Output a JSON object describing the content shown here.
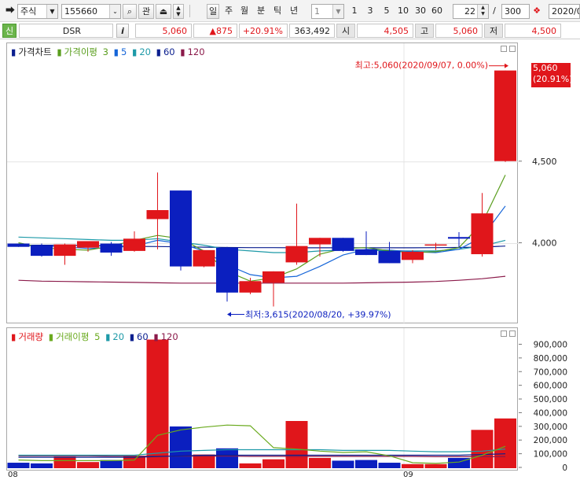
{
  "toolbar": {
    "market": "주식",
    "code": "155660",
    "search_label": "관",
    "periods": [
      "일",
      "주",
      "월",
      "분",
      "틱",
      "년"
    ],
    "active_period": "일",
    "interval_value": "1",
    "quick_intervals": [
      "1",
      "3",
      "5",
      "10",
      "30",
      "60"
    ],
    "display_count": "22",
    "total_count": "300",
    "count_separator": "/",
    "date_value": "2020/0"
  },
  "quote": {
    "signal": "신",
    "name": "DSR",
    "info_label": "i",
    "price": "5,060",
    "change": "▲875",
    "change_rate": "+20.91%",
    "volume": "363,492",
    "open_label": "시",
    "open": "4,505",
    "high_label": "고",
    "high": "5,060",
    "low_label": "저",
    "low": "4,500"
  },
  "price_panel": {
    "legend": {
      "title": "가격차트",
      "ma_title": "가격이평",
      "ma_periods": [
        "3",
        "5",
        "20",
        "60",
        "120"
      ]
    },
    "high_annotation": "최고:5,060(2020/09/07, 0.00%)",
    "low_annotation": "최저:3,615(2020/08/20, +39.97%)",
    "current_tag": {
      "price": "5,060",
      "rate": "(20.91%)"
    },
    "axis_ticks": [
      "4,500",
      "4,000"
    ]
  },
  "volume_panel": {
    "legend": {
      "title": "거래량",
      "ma_title": "거래이평",
      "ma_periods": [
        "5",
        "20",
        "60",
        "120"
      ]
    },
    "axis_ticks": [
      "900,000",
      "800,000",
      "700,000",
      "600,000",
      "500,000",
      "400,000",
      "300,000",
      "200,000",
      "100,000",
      "0"
    ]
  },
  "date_axis": {
    "labels": [
      "08",
      "09"
    ]
  },
  "colors": {
    "up": "#e0161b",
    "down": "#0b1fbf",
    "ma3": "#5a9e1e",
    "ma5": "#1565d8",
    "ma20": "#1e9aa8",
    "ma60": "#0b1f8f",
    "ma120": "#8b1a4a",
    "vma5": "#6aaa1e"
  },
  "chart_data": {
    "type": "candlestick",
    "ylim": [
      3540,
      5140
    ],
    "candles": [
      {
        "o": 4000,
        "h": 4000,
        "l": 3980,
        "c": 3980
      },
      {
        "o": 3990,
        "h": 4000,
        "l": 3920,
        "c": 3925
      },
      {
        "o": 3925,
        "h": 4000,
        "l": 3870,
        "c": 3995
      },
      {
        "o": 3975,
        "h": 4005,
        "l": 3950,
        "c": 4015
      },
      {
        "o": 4000,
        "h": 4010,
        "l": 3925,
        "c": 3945
      },
      {
        "o": 3955,
        "h": 4075,
        "l": 3950,
        "c": 4030
      },
      {
        "o": 4150,
        "h": 4435,
        "l": 3965,
        "c": 4205
      },
      {
        "o": 4325,
        "h": 4325,
        "l": 3835,
        "c": 3860
      },
      {
        "o": 3860,
        "h": 3960,
        "l": 3855,
        "c": 3960
      },
      {
        "o": 3975,
        "h": 3980,
        "l": 3645,
        "c": 3700
      },
      {
        "o": 3700,
        "h": 3790,
        "l": 3690,
        "c": 3770
      },
      {
        "o": 3760,
        "h": 3830,
        "l": 3615,
        "c": 3830
      },
      {
        "o": 3885,
        "h": 4245,
        "l": 3870,
        "c": 3985
      },
      {
        "o": 3995,
        "h": 4035,
        "l": 3920,
        "c": 4035
      },
      {
        "o": 4035,
        "h": 4035,
        "l": 3950,
        "c": 3955
      },
      {
        "o": 3965,
        "h": 4075,
        "l": 3930,
        "c": 3930
      },
      {
        "o": 3955,
        "h": 4010,
        "l": 3880,
        "c": 3880
      },
      {
        "o": 3900,
        "h": 3960,
        "l": 3880,
        "c": 3950
      },
      {
        "o": 3995,
        "h": 4005,
        "l": 3960,
        "c": 3995
      },
      {
        "o": 4040,
        "h": 4070,
        "l": 3975,
        "c": 4030
      },
      {
        "o": 3935,
        "h": 4310,
        "l": 3920,
        "c": 4185
      },
      {
        "o": 4505,
        "h": 5060,
        "l": 4500,
        "c": 5060
      }
    ],
    "ma3": [
      4005,
      3975,
      3965,
      3960,
      3985,
      4020,
      4050,
      4030,
      3955,
      3830,
      3770,
      3790,
      3845,
      3935,
      3970,
      3975,
      3955,
      3945,
      3950,
      3975,
      4125,
      4420
    ],
    "ma5": [
      3990,
      3985,
      3980,
      3970,
      3975,
      3985,
      4020,
      4000,
      3955,
      3870,
      3810,
      3790,
      3800,
      3860,
      3930,
      3965,
      3960,
      3950,
      3945,
      3965,
      4040,
      4230
    ],
    "ma20": [
      4040,
      4035,
      4030,
      4025,
      4020,
      4020,
      4030,
      4010,
      3990,
      3965,
      3955,
      3945,
      3945,
      3955,
      3960,
      3960,
      3955,
      3955,
      3955,
      3965,
      3985,
      4020
    ],
    "ma60": [
      3990,
      3990,
      3990,
      3988,
      3985,
      3983,
      3982,
      3980,
      3978,
      3976,
      3975,
      3975,
      3974,
      3974,
      3974,
      3974,
      3974,
      3974,
      3975,
      3976,
      3978,
      3985
    ],
    "ma120": [
      3775,
      3770,
      3768,
      3766,
      3764,
      3762,
      3760,
      3758,
      3758,
      3758,
      3758,
      3758,
      3758,
      3758,
      3758,
      3760,
      3762,
      3764,
      3768,
      3775,
      3785,
      3800
    ],
    "volume": {
      "ylim": [
        0,
        920000
      ],
      "values": [
        40000,
        35000,
        85000,
        45000,
        60000,
        90000,
        940000,
        305000,
        100000,
        145000,
        35000,
        65000,
        345000,
        75000,
        55000,
        60000,
        40000,
        30000,
        30000,
        75000,
        280000,
        363492
      ],
      "vma5": [
        60000,
        55000,
        55000,
        55000,
        55000,
        60000,
        240000,
        280000,
        300000,
        315000,
        310000,
        150000,
        140000,
        125000,
        115000,
        120000,
        90000,
        40000,
        35000,
        45000,
        95000,
        160000
      ],
      "vma20": [
        95000,
        95000,
        95000,
        95000,
        95000,
        95000,
        110000,
        125000,
        130000,
        135000,
        135000,
        135000,
        135000,
        135000,
        130000,
        130000,
        130000,
        125000,
        120000,
        120000,
        125000,
        140000
      ],
      "vma60": [
        80000,
        80000,
        80000,
        80000,
        80000,
        80000,
        85000,
        90000,
        95000,
        95000,
        95000,
        95000,
        95000,
        95000,
        95000,
        95000,
        95000,
        95000,
        95000,
        95000,
        100000,
        105000
      ],
      "vma120": [
        90000,
        90000,
        90000,
        90000,
        88000,
        88000,
        88000,
        88000,
        88000,
        88000,
        86000,
        86000,
        86000,
        86000,
        86000,
        86000,
        86000,
        86000,
        84000,
        84000,
        84000,
        84000
      ]
    }
  }
}
